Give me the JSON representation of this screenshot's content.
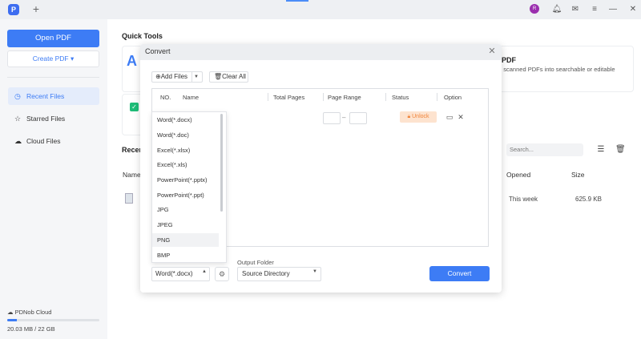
{
  "titlebar": {
    "app_logo": "P",
    "new_tab": "+",
    "avatar_initial": "R",
    "icons": [
      "bell-icon",
      "message-icon",
      "menu-icon",
      "minimize-icon",
      "maximize-icon",
      "close-icon"
    ]
  },
  "sidebar": {
    "open_pdf": "Open PDF",
    "create_pdf": "Create PDF ▾",
    "nav": [
      {
        "label": "Recent Files",
        "icon": "clock-icon",
        "active": true
      },
      {
        "label": "Starred Files",
        "icon": "star-icon",
        "active": false
      },
      {
        "label": "Cloud Files",
        "icon": "cloud-icon",
        "active": false
      }
    ],
    "cloud": {
      "label": "PDNob Cloud",
      "usage": "20.03 MB  /  22 GB",
      "fraction_used": 0.001
    }
  },
  "main": {
    "quick_tools_title": "Quick Tools",
    "ocr_title": "PDF",
    "ocr_desc": "e scanned PDFs into searchable or editable",
    "recent_title": "Recen",
    "name_header": "Name",
    "search_placeholder": "Search...",
    "opened_header": "Opened",
    "size_header": "Size",
    "file_opened": "This week",
    "file_size": "625.9 KB"
  },
  "modal": {
    "title": "Convert",
    "add_files": "Add Files",
    "clear_all": "Clear All",
    "columns": {
      "no": "NO.",
      "name": "Name",
      "total_pages": "Total Pages",
      "page_range": "Page Range",
      "status": "Status",
      "option": "Option"
    },
    "range_dash": "–",
    "unlock": "Unlock",
    "formats": [
      "Word(*.docx)",
      "Word(*.doc)",
      "Excel(*.xlsx)",
      "Excel(*.xls)",
      "PowerPoint(*.pptx)",
      "PowerPoint(*.ppt)",
      "JPG",
      "JPEG",
      "PNG",
      "BMP"
    ],
    "highlighted_format": "PNG",
    "selected_format": "Word(*.docx)",
    "output_folder_label": "Output Folder",
    "output_folder_value": "Source Directory",
    "convert_button": "Convert"
  }
}
